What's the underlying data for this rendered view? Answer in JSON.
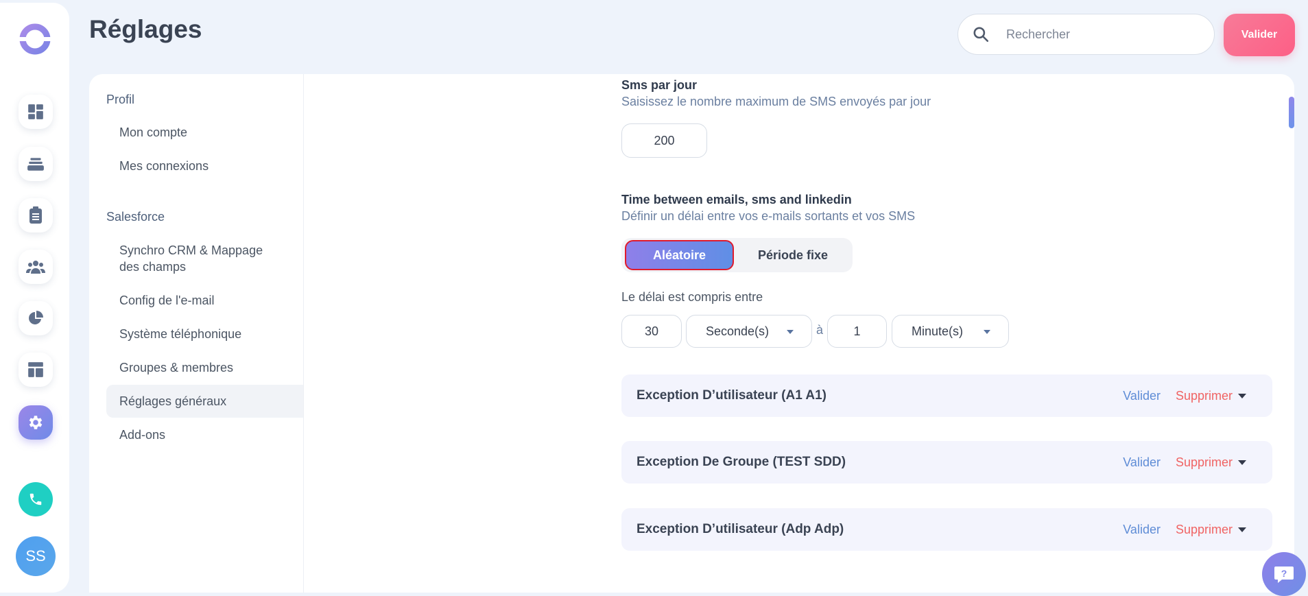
{
  "page": {
    "title": "Réglages"
  },
  "search": {
    "placeholder": "Rechercher"
  },
  "header": {
    "validate_label": "Valider"
  },
  "rail": {
    "avatar_initials": "SS",
    "items": [
      {
        "icon": "dashboard-icon"
      },
      {
        "icon": "inbox-icon"
      },
      {
        "icon": "clipboard-icon"
      },
      {
        "icon": "team-icon"
      },
      {
        "icon": "pie-chart-icon"
      },
      {
        "icon": "layout-icon"
      },
      {
        "icon": "gear-icon",
        "active": true
      }
    ]
  },
  "settings_nav": {
    "sections": [
      {
        "title": "Profil",
        "items": [
          "Mon compte",
          "Mes connexions"
        ]
      },
      {
        "title": "Salesforce",
        "items": [
          "Synchro CRM & Mappage des champs",
          "Config de l'e-mail",
          "Système téléphonique",
          "Groupes & membres",
          "Réglages généraux",
          "Add-ons"
        ]
      }
    ],
    "active_item": "Réglages généraux"
  },
  "sms_per_day": {
    "title": "Sms par jour",
    "description": "Saisissez le nombre maximum de SMS envoyés par jour",
    "value": "200"
  },
  "time_between": {
    "title": "Time between emails, sms and linkedin",
    "description": "Définir un délai entre vos e-mails sortants et vos SMS",
    "options": [
      "Aléatoire",
      "Période fixe"
    ],
    "selected": "Aléatoire",
    "range_label": "Le délai est compris entre",
    "min_value": "30",
    "min_unit": "Seconde(s)",
    "separator": "à",
    "max_value": "1",
    "max_unit": "Minute(s)"
  },
  "exceptions": [
    {
      "title": "Exception D’utilisateur (A1 A1)",
      "validate": "Valider",
      "delete": "Supprimer"
    },
    {
      "title": "Exception De Groupe (TEST SDD)",
      "validate": "Valider",
      "delete": "Supprimer"
    },
    {
      "title": "Exception D’utilisateur (Adp Adp)",
      "validate": "Valider",
      "delete": "Supprimer"
    }
  ],
  "colors": {
    "accent_gradient_start": "#8f7fe9",
    "accent_gradient_end": "#5f8fe6",
    "validate_button": "#fd5f86",
    "delete_text": "#f06363",
    "validate_text": "#5e8cd6",
    "phone_button": "#1fcfc3"
  }
}
